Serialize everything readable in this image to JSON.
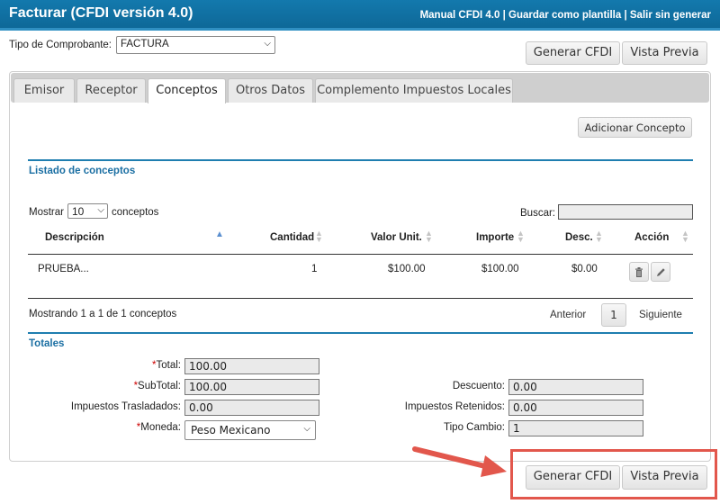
{
  "header": {
    "title": "Facturar (CFDI versión 4.0)",
    "links": [
      "Manual CFDI 4.0",
      "Guardar como plantilla",
      "Salir sin generar"
    ],
    "separator": " | "
  },
  "tipo": {
    "label": "Tipo de Comprobante:",
    "value": "FACTURA"
  },
  "actions": {
    "generar": "Generar CFDI",
    "vista": "Vista Previa"
  },
  "tabs": [
    "Emisor",
    "Receptor",
    "Conceptos",
    "Otros Datos",
    "Complemento Impuestos Locales"
  ],
  "active_tab": "Conceptos",
  "conceptos": {
    "add_button": "Adicionar Concepto",
    "section_title": "Listado de conceptos",
    "mostrar_label": "Mostrar",
    "mostrar_value": "10",
    "mostrar_suffix": "conceptos",
    "buscar_label": "Buscar:",
    "columns": [
      "Descripción",
      "Cantidad",
      "Valor Unit.",
      "Importe",
      "Desc.",
      "Acción"
    ],
    "rows": [
      {
        "descripcion": "PRUEBA...",
        "cantidad": "1",
        "valor_unit": "$100.00",
        "importe": "$100.00",
        "desc": "$0.00"
      }
    ],
    "info": "Mostrando 1 a 1 de 1 conceptos",
    "pagination": {
      "prev": "Anterior",
      "page": "1",
      "next": "Siguiente"
    }
  },
  "totales": {
    "title": "Totales",
    "total_label": "Total:",
    "total": "100.00",
    "subtotal_label": "SubTotal:",
    "subtotal": "100.00",
    "trasladados_label": "Impuestos Trasladados:",
    "trasladados": "0.00",
    "moneda_label": "Moneda:",
    "moneda": "Peso Mexicano",
    "descuento_label": "Descuento:",
    "descuento": "0.00",
    "retenidos_label": "Impuestos Retenidos:",
    "retenidos": "0.00",
    "tipo_cambio_label": "Tipo Cambio:",
    "tipo_cambio": "1",
    "required_mark": "*"
  },
  "colors": {
    "header": "#1379ad",
    "accent": "#1f7eb0",
    "highlight": "#e2574c"
  }
}
